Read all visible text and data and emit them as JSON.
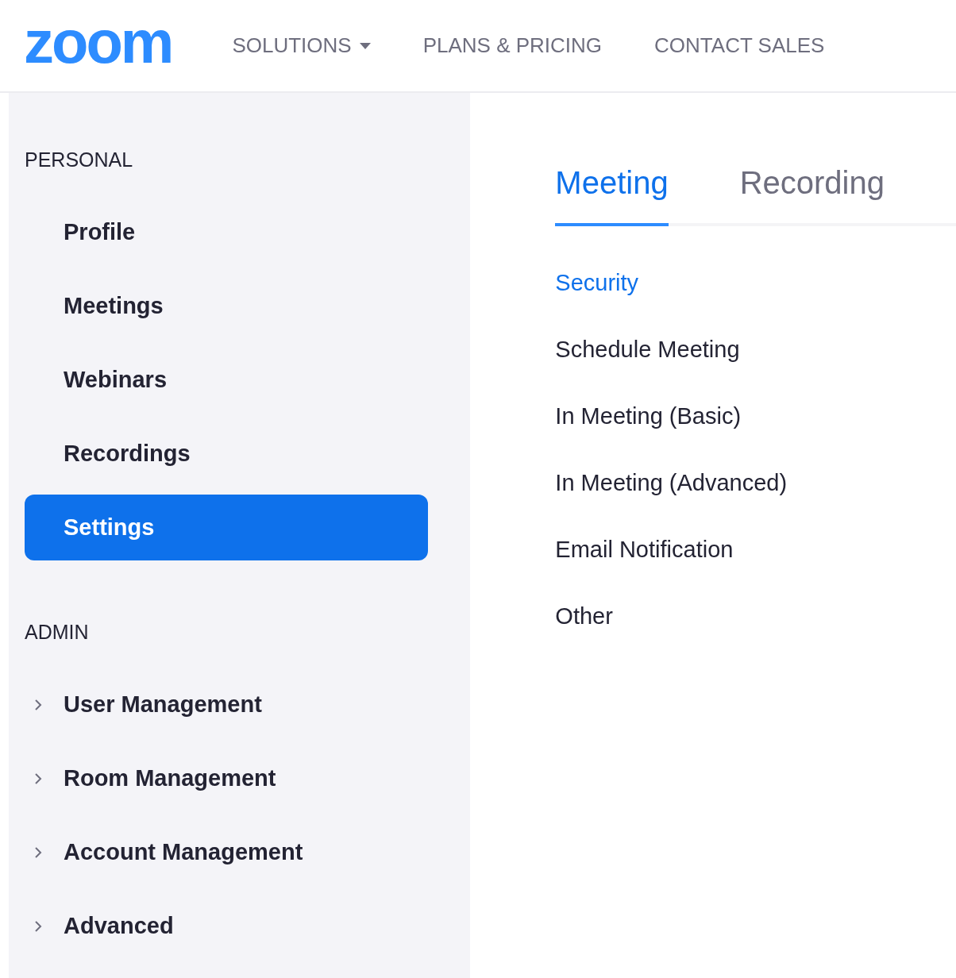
{
  "logo": "zoom",
  "nav": [
    {
      "label": "SOLUTIONS",
      "dropdown": true
    },
    {
      "label": "PLANS & PRICING",
      "dropdown": false
    },
    {
      "label": "CONTACT SALES",
      "dropdown": false
    }
  ],
  "sidebar": {
    "sections": [
      {
        "title": "PERSONAL",
        "items": [
          {
            "label": "Profile",
            "selected": false,
            "expandable": false
          },
          {
            "label": "Meetings",
            "selected": false,
            "expandable": false
          },
          {
            "label": "Webinars",
            "selected": false,
            "expandable": false
          },
          {
            "label": "Recordings",
            "selected": false,
            "expandable": false
          },
          {
            "label": "Settings",
            "selected": true,
            "expandable": false
          }
        ]
      },
      {
        "title": "ADMIN",
        "items": [
          {
            "label": "User Management",
            "selected": false,
            "expandable": true
          },
          {
            "label": "Room Management",
            "selected": false,
            "expandable": true
          },
          {
            "label": "Account Management",
            "selected": false,
            "expandable": true
          },
          {
            "label": "Advanced",
            "selected": false,
            "expandable": true
          }
        ]
      }
    ]
  },
  "tabs": [
    {
      "label": "Meeting",
      "selected": true
    },
    {
      "label": "Recording",
      "selected": false
    }
  ],
  "sections": [
    {
      "label": "Security",
      "selected": true
    },
    {
      "label": "Schedule Meeting",
      "selected": false
    },
    {
      "label": "In Meeting (Basic)",
      "selected": false
    },
    {
      "label": "In Meeting (Advanced)",
      "selected": false
    },
    {
      "label": "Email Notification",
      "selected": false
    },
    {
      "label": "Other",
      "selected": false
    }
  ]
}
